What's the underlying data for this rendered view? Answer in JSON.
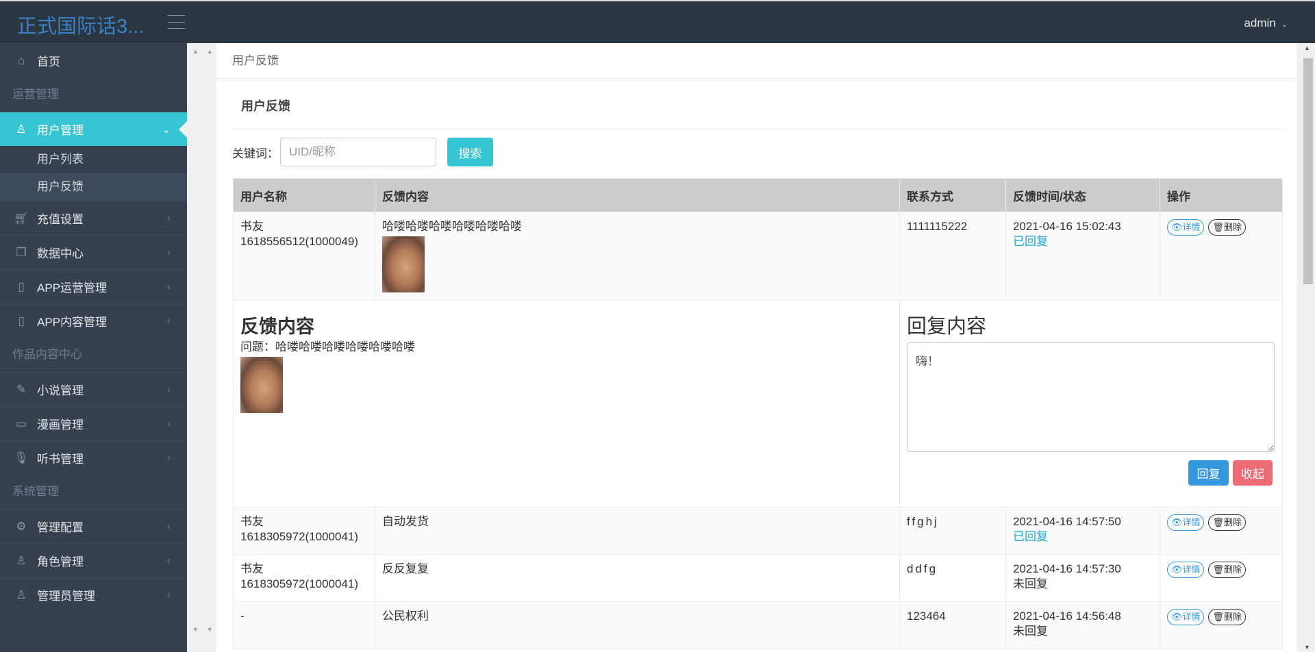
{
  "header": {
    "title": "正式国际话3...",
    "user": "admin"
  },
  "sidebar": {
    "home": "首页",
    "group_ops": "运营管理",
    "user_mgmt": "用户管理",
    "sub_items": [
      "用户列表",
      "用户反馈"
    ],
    "ops_items": [
      "充值设置",
      "数据中心",
      "APP运营管理",
      "APP内容管理"
    ],
    "group_works": "作品内容中心",
    "works_items": [
      "小说管理",
      "漫画管理",
      "听书管理"
    ],
    "group_sys": "系统管理",
    "sys_items": [
      "管理配置",
      "角色管理",
      "管理员管理"
    ]
  },
  "breadcrumb": "用户反馈",
  "page_title": "用户反馈",
  "search": {
    "label": "关键词：",
    "placeholder": "UID/昵称",
    "button": "搜索"
  },
  "table": {
    "headers": [
      "用户名称",
      "反馈内容",
      "联系方式",
      "反馈时间/状态",
      "操作"
    ],
    "detail_label": "详情",
    "delete_label": "删除",
    "rows": [
      {
        "name": "书友 1618556512(1000049)",
        "content": "哈喽哈喽哈喽哈喽哈喽哈喽",
        "contact": "1111115222",
        "time": "2021-04-16 15:02:43",
        "status": "已回复"
      },
      {
        "name": "书友 1618305972(1000041)",
        "content": "自动发货",
        "contact": "ffghj",
        "time": "2021-04-16 14:57:50",
        "status": "已回复"
      },
      {
        "name": "书友 1618305972(1000041)",
        "content": "反反复复",
        "contact": "ddfg",
        "time": "2021-04-16 14:57:30",
        "status": "未回复"
      },
      {
        "name": "-",
        "content": "公民权利",
        "contact": "123464",
        "time": "2021-04-16 14:56:48",
        "status": "未回复"
      }
    ]
  },
  "expanded": {
    "feedback_title": "反馈内容",
    "question": "问题：哈喽哈喽哈喽哈喽哈喽哈喽",
    "reply_title": "回复内容",
    "reply_text": "嗨！",
    "reply_button": "回复",
    "fold_button": "收起"
  }
}
